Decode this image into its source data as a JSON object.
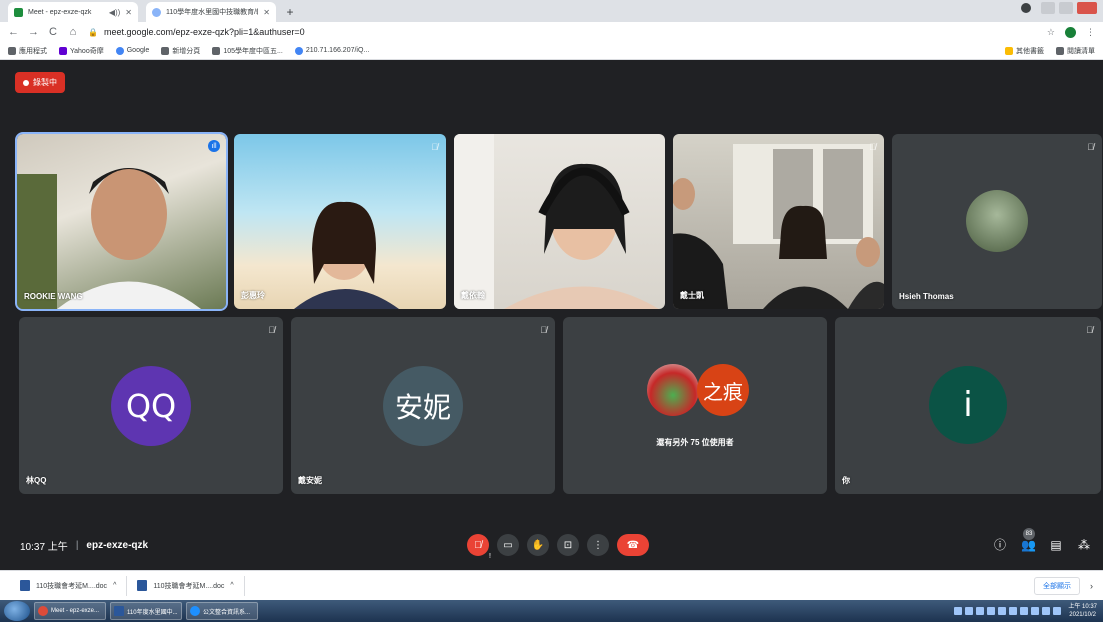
{
  "browser": {
    "tabs": [
      {
        "title": "Meet - epz-exze-qzk",
        "active": true
      },
      {
        "title": "110學年度水里國中技職教育/轉職...",
        "active": false
      }
    ],
    "url": "meet.google.com/epz-exze-qzk?pli=1&authuser=0",
    "bookmarks": [
      "應用程式",
      "Yahoo奇摩",
      "Google",
      "新增分頁",
      "105學年度中區五...",
      "210.71.166.207/iQ..."
    ],
    "bookmarks_right": [
      "其他書籤",
      "閱讀清單"
    ]
  },
  "meet": {
    "recording_label": "錄製中",
    "time": "10:37 上午",
    "meeting_code": "epz-exze-qzk",
    "participant_count": "83",
    "tiles_row1": [
      {
        "name": "ROOKIE WANG",
        "speaking": true
      },
      {
        "name": "彭惠玲"
      },
      {
        "name": "戴依翰"
      },
      {
        "name": "戴士凱"
      },
      {
        "name": "Hsieh Thomas"
      }
    ],
    "tiles_row2": [
      {
        "name": "林QQ",
        "avatar_text": "QQ",
        "avatar_color": "#5e35b1"
      },
      {
        "name": "戴安妮",
        "avatar_text": "安妮",
        "avatar_color": "#455a64"
      },
      {
        "name": "",
        "avatar_text": "之痕",
        "avatar_color": "#d84315",
        "others_label": "還有另外 75 位使用者"
      },
      {
        "name": "你",
        "avatar_text": "i",
        "avatar_color": "#0b5345"
      }
    ]
  },
  "downloads": {
    "items": [
      "110技職會考延M....doc",
      "110技職會考延M....doc"
    ],
    "show_all": "全部顯示"
  },
  "taskbar": {
    "buttons": [
      "Meet - epz-exze...",
      "110年度水里國中...",
      "公文整合資訊系..."
    ],
    "clock_time": "上午 10:37",
    "clock_date": "2021/10/2"
  }
}
